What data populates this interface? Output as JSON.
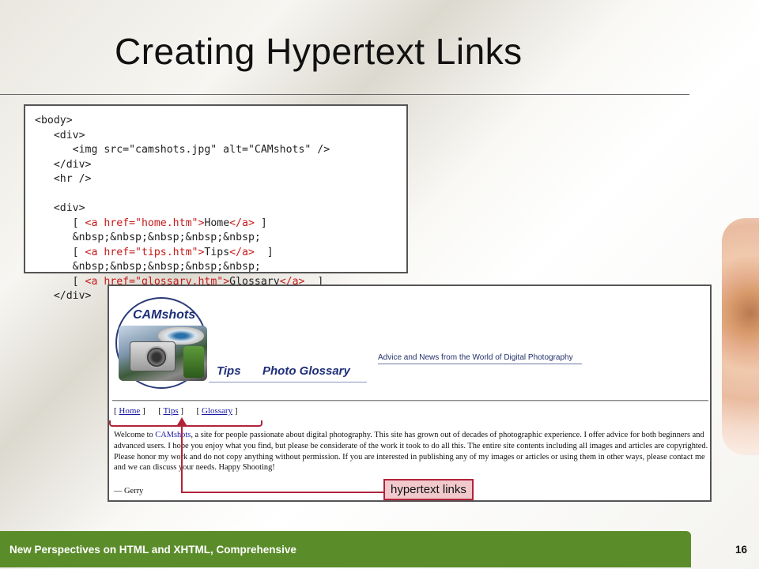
{
  "slide": {
    "title": "Creating Hypertext Links",
    "footer_text": "New Perspectives on HTML and XHTML, Comprehensive",
    "page_number": "16"
  },
  "code": {
    "lines": [
      [
        "<body>"
      ],
      [
        "   <div>"
      ],
      [
        "      <img src=\"camshots.jpg\" alt=\"CAMshots\" />"
      ],
      [
        "   </div>"
      ],
      [
        "   <hr />"
      ],
      [
        ""
      ],
      [
        "   <div>"
      ],
      [
        "      [ ",
        "<a href=\"home.htm\">",
        "Home",
        "</a>",
        " ]"
      ],
      [
        "      &nbsp;&nbsp;&nbsp;&nbsp;&nbsp;"
      ],
      [
        "      [ ",
        "<a href=\"tips.htm\">",
        "Tips",
        "</a>",
        "  ]"
      ],
      [
        "      &nbsp;&nbsp;&nbsp;&nbsp;&nbsp;"
      ],
      [
        "      [ ",
        "<a href=\"glossary.htm\">",
        "Glossary",
        "</a>",
        "  ]"
      ],
      [
        "   </div>"
      ]
    ]
  },
  "browser": {
    "logo_text": "CAMshots",
    "tagline": "Advice and News from the World of Digital Photography",
    "nav_images": [
      "Tips",
      "Photo Glossary"
    ],
    "links": {
      "open1": "[ ",
      "home": "Home",
      "close1": " ]      ",
      "open2": "[ ",
      "tips": "Tips",
      "close2": " ]      ",
      "open3": "[ ",
      "glossary": "Glossary",
      "close3": " ]"
    },
    "welcome_before": "Welcome to ",
    "welcome_link": "CAMshots",
    "welcome_after": ", a site for people passionate about digital photography. This site has grown out of decades of photographic experience. I offer advice for both beginners and advanced users. I hope you enjoy what you find, but please be considerate of the work it took to do all this. The entire site contents including all images and articles are copyrighted. Please honor my work and do not copy anything without permission. If you are interested in publishing any of my images or articles or using them in other ways, please contact me and we can discuss your needs. Happy Shooting!",
    "signature": "— Gerry"
  },
  "callout": {
    "label": "hypertext links"
  },
  "colors": {
    "footer_green": "#5b8c2a",
    "code_highlight": "#c41a1a",
    "callout_border": "#b0243a",
    "callout_fill": "#f1c9cd"
  }
}
